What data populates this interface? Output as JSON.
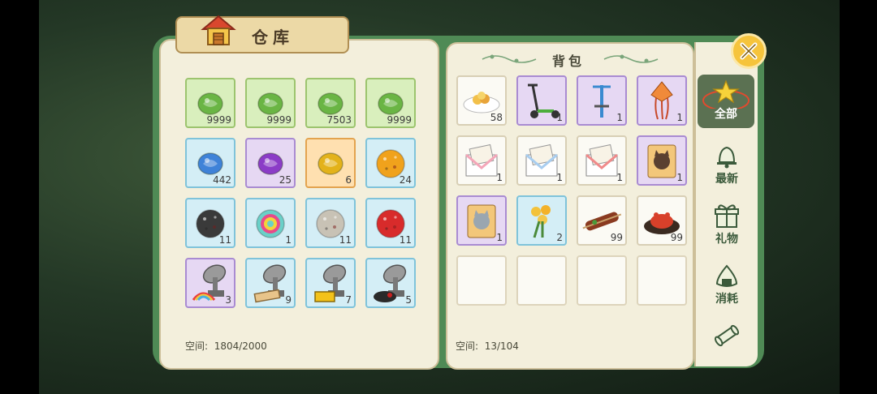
{
  "warehouse": {
    "title": "仓库",
    "space_label": "空间:",
    "space_value": "1804/2000",
    "items": [
      {
        "icon": "green-gem-icon",
        "count": "9999",
        "style": "green",
        "color": "#6ab544"
      },
      {
        "icon": "green-gem-icon",
        "count": "9999",
        "style": "green",
        "color": "#6ab544"
      },
      {
        "icon": "green-gem-icon",
        "count": "7503",
        "style": "green",
        "color": "#6ab544"
      },
      {
        "icon": "green-gem-icon",
        "count": "9999",
        "style": "green",
        "color": "#6ab544"
      },
      {
        "icon": "blue-gem-icon",
        "count": "442",
        "style": "blue",
        "color": "#3f82d8"
      },
      {
        "icon": "purple-gem-icon",
        "count": "25",
        "style": "purple",
        "color": "#8b3cc7"
      },
      {
        "icon": "gold-gem-icon",
        "count": "6",
        "style": "orange",
        "color": "#e3b21a"
      },
      {
        "icon": "orange-ore-icon",
        "count": "24",
        "style": "blue",
        "color": "#f0a21c"
      },
      {
        "icon": "black-ore-icon",
        "count": "11",
        "style": "blue",
        "color": "#3a3a3a"
      },
      {
        "icon": "rainbow-ore-icon",
        "count": "1",
        "style": "blue",
        "color": "#6ad0c8"
      },
      {
        "icon": "gray-ore-icon",
        "count": "11",
        "style": "blue",
        "color": "#c8c2b5"
      },
      {
        "icon": "red-ore-icon",
        "count": "11",
        "style": "blue",
        "color": "#d82b2b"
      },
      {
        "icon": "satellite-rainbow-icon",
        "count": "3",
        "style": "purple",
        "color": "#9a9a9a"
      },
      {
        "icon": "satellite-wood-icon",
        "count": "9",
        "style": "blue",
        "color": "#9a9a9a"
      },
      {
        "icon": "satellite-gold-icon",
        "count": "7",
        "style": "blue",
        "color": "#9a9a9a"
      },
      {
        "icon": "satellite-dark-icon",
        "count": "5",
        "style": "blue",
        "color": "#9a9a9a"
      }
    ]
  },
  "backpack": {
    "title": "背包",
    "space_label": "空间:",
    "space_value": "13/104",
    "items": [
      {
        "icon": "food-plate-icon",
        "count": "58",
        "style": "white"
      },
      {
        "icon": "scooter-icon",
        "count": "1",
        "style": "purple"
      },
      {
        "icon": "pogo-stick-icon",
        "count": "1",
        "style": "purple"
      },
      {
        "icon": "kite-icon",
        "count": "1",
        "style": "purple"
      },
      {
        "icon": "letter-pink-icon",
        "count": "1",
        "style": "white"
      },
      {
        "icon": "letter-blue-icon",
        "count": "1",
        "style": "white"
      },
      {
        "icon": "letter-red-icon",
        "count": "1",
        "style": "white"
      },
      {
        "icon": "cat-food-bag-icon",
        "count": "1",
        "style": "purple"
      },
      {
        "icon": "cat-food-bag-gray-icon",
        "count": "1",
        "style": "purple"
      },
      {
        "icon": "flower-bouquet-icon",
        "count": "2",
        "style": "blue"
      },
      {
        "icon": "skewer-icon",
        "count": "99",
        "style": "white"
      },
      {
        "icon": "crab-dish-icon",
        "count": "99",
        "style": "white"
      },
      {
        "icon": "empty-slot",
        "count": "",
        "style": "empty"
      },
      {
        "icon": "empty-slot",
        "count": "",
        "style": "empty"
      },
      {
        "icon": "empty-slot",
        "count": "",
        "style": "empty"
      },
      {
        "icon": "empty-slot",
        "count": "",
        "style": "empty"
      }
    ]
  },
  "tabs": [
    {
      "label": "全部",
      "icon": "star-icon",
      "active": true
    },
    {
      "label": "最新",
      "icon": "bell-icon",
      "active": false
    },
    {
      "label": "礼物",
      "icon": "gift-icon",
      "active": false
    },
    {
      "label": "消耗",
      "icon": "rice-ball-icon",
      "active": false
    },
    {
      "label": "",
      "icon": "scroll-icon",
      "active": false
    }
  ],
  "close_icon": "close-icon",
  "accent": "#f6c43c"
}
